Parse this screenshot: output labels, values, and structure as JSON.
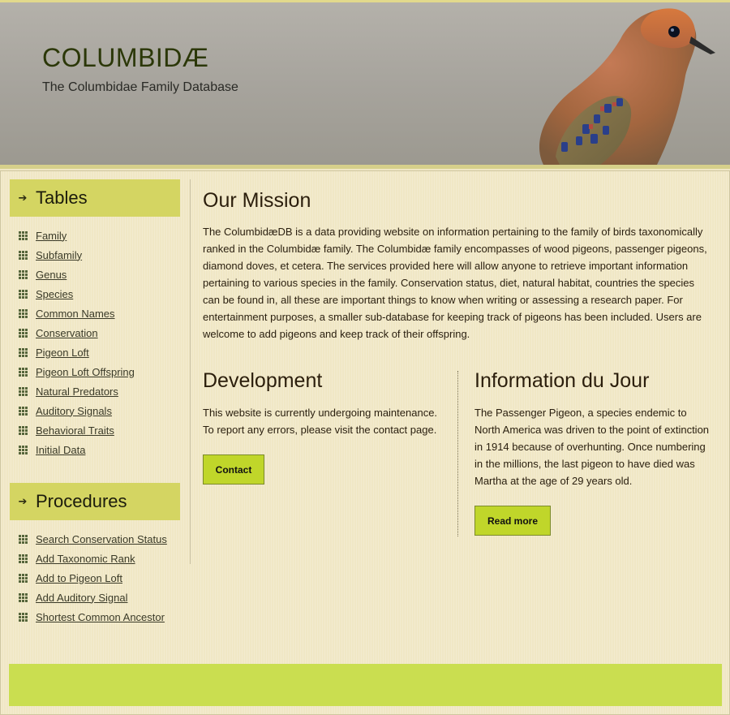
{
  "header": {
    "title": "COLUMBIDÆ",
    "tagline": "The Columbidae Family Database"
  },
  "sidebar": {
    "tables_heading": "Tables",
    "tables": [
      {
        "label": "Family"
      },
      {
        "label": "Subfamily"
      },
      {
        "label": "Genus"
      },
      {
        "label": "Species"
      },
      {
        "label": "Common Names"
      },
      {
        "label": "Conservation"
      },
      {
        "label": "Pigeon Loft"
      },
      {
        "label": "Pigeon Loft Offspring"
      },
      {
        "label": "Natural Predators"
      },
      {
        "label": "Auditory Signals"
      },
      {
        "label": "Behavioral Traits"
      },
      {
        "label": "Initial Data"
      }
    ],
    "procedures_heading": "Procedures",
    "procedures": [
      {
        "label": "Search Conservation Status"
      },
      {
        "label": "Add Taxonomic Rank"
      },
      {
        "label": "Add to Pigeon Loft"
      },
      {
        "label": "Add Auditory Signal"
      },
      {
        "label": "Shortest Common Ancestor"
      }
    ]
  },
  "main": {
    "mission_title": "Our Mission",
    "mission_text": "The ColumbidæDB is a data providing website on information pertaining to the family of birds taxonomically ranked in the Columbidæ family. The Columbidæ family encompasses of wood pigeons, passenger pigeons, diamond doves, et cetera. The services provided here will allow anyone to retrieve important information pertaining to various species in the family. Conservation status, diet, natural habitat, countries the species can be found in, all these are important things to know when writing or assessing a research paper. For entertainment purposes, a smaller sub-database for keeping track of pigeons has been included. Users are welcome to add pigeons and keep track of their offspring.",
    "development_title": "Development",
    "development_text": "This website is currently undergoing maintenance. To report any errors, please visit the contact page.",
    "contact_label": "Contact",
    "info_title": "Information du Jour",
    "info_text": "The Passenger Pigeon, a species endemic to North America was driven to the point of extinction in 1914 because of overhunting. Once numbering in the millions, the last pigeon to have died was Martha at the age of 29 years old.",
    "read_more_label": "Read more"
  },
  "icons": {
    "heading_arrow": "arrow-right-icon",
    "list_bullet": "grid-bullet-icon"
  },
  "colors": {
    "accent": "#c0d62a",
    "sidebar_heading": "#d4d562",
    "footer": "#cade50",
    "background": "#efe6c4"
  }
}
